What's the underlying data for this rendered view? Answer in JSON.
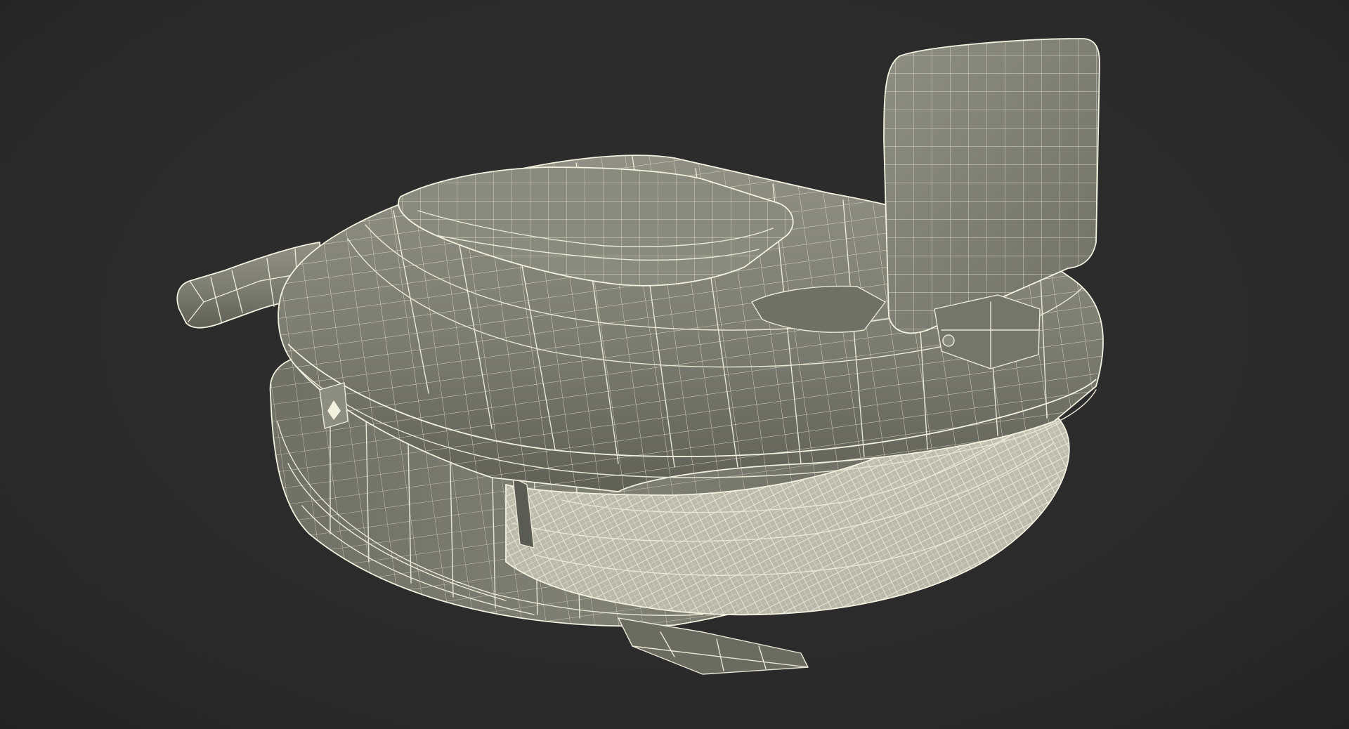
{
  "scene": {
    "subject": "3d-wireframe-model",
    "colors": {
      "background": "#2a2a2a",
      "mesh_fill": "#7e7f73",
      "mesh_fill_dark": "#66675c",
      "mesh_fill_light": "#94958a",
      "wire": "#e9e7d6",
      "tire_fill": "#b8b7a8"
    }
  }
}
